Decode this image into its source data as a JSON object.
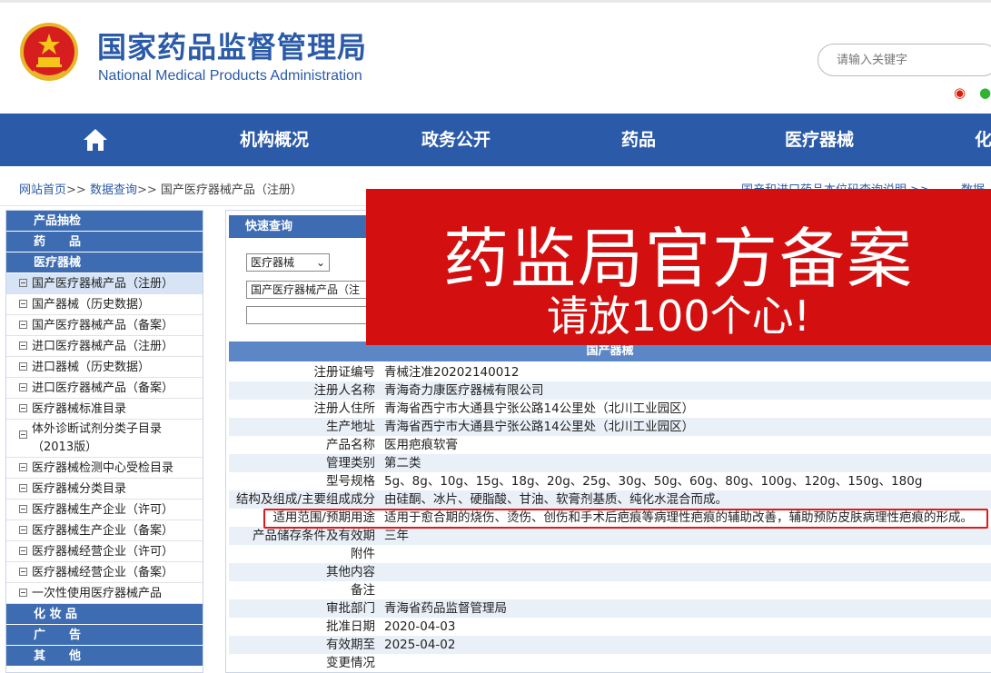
{
  "header": {
    "title_cn": "国家药品监督管理局",
    "title_en": "National Medical Products Administration",
    "search_placeholder": "请输入关键字"
  },
  "nav": {
    "items": [
      "机构概况",
      "政务公开",
      "药品",
      "医疗器械",
      "化"
    ]
  },
  "breadcrumb": {
    "home": "网站首页",
    "sep": ">>",
    "data_query": "数据查询",
    "current": "国产医疗器械产品（注册）",
    "right_link": "国产和进口药品本位码查询说明  >>",
    "right_link2": "数据查"
  },
  "sidebar": {
    "categories": [
      "产品抽检",
      "药　　品",
      "医疗器械",
      "化 妆 品",
      "广　　告",
      "其　　他"
    ],
    "items": [
      "国产医疗器械产品（注册）",
      "国产器械（历史数据）",
      "国产医疗器械产品（备案）",
      "进口医疗器械产品（注册）",
      "进口器械（历史数据）",
      "进口医疗器械产品（备案）",
      "医疗器械标准目录",
      "体外诊断试剂分类子目录（2013版）",
      "医疗器械检测中心受检目录",
      "医疗器械分类目录",
      "医疗器械生产企业（许可）",
      "医疗器械生产企业（备案）",
      "医疗器械经营企业（许可）",
      "医疗器械经营企业（备案）",
      "一次性使用医疗器械产品"
    ]
  },
  "quick_search": {
    "title": "快速查询",
    "category_select": "医疗器械",
    "db_select": "国产医疗器械产品（注"
  },
  "banner": {
    "main": "药监局官方备案",
    "sub": "请放100个心!"
  },
  "table": {
    "title": "国产器械",
    "rows": [
      {
        "k": "注册证编号",
        "v": "青械注准20202140012"
      },
      {
        "k": "注册人名称",
        "v": "青海奇力康医疗器械有限公司"
      },
      {
        "k": "注册人住所",
        "v": "青海省西宁市大通县宁张公路14公里处（北川工业园区）"
      },
      {
        "k": "生产地址",
        "v": "青海省西宁市大通县宁张公路14公里处（北川工业园区）"
      },
      {
        "k": "产品名称",
        "v": "医用疤痕软膏"
      },
      {
        "k": "管理类别",
        "v": "第二类"
      },
      {
        "k": "型号规格",
        "v": "5g、8g、10g、15g、18g、20g、25g、30g、50g、60g、80g、100g、120g、150g、180g"
      },
      {
        "k": "结构及组成/主要组成成分",
        "v": "由硅酮、冰片、硬脂酸、甘油、软膏剂基质、纯化水混合而成。"
      },
      {
        "k": "适用范围/预期用途",
        "v": "适用于愈合期的烧伤、烫伤、创伤和手术后疤痕等病理性疤痕的辅助改善，辅助预防皮肤病理性疤痕的形成。"
      },
      {
        "k": "产品储存条件及有效期",
        "v": "三年"
      },
      {
        "k": "附件",
        "v": ""
      },
      {
        "k": "其他内容",
        "v": ""
      },
      {
        "k": "备注",
        "v": ""
      },
      {
        "k": "审批部门",
        "v": "青海省药品监督管理局"
      },
      {
        "k": "批准日期",
        "v": "2020-04-03"
      },
      {
        "k": "有效期至",
        "v": "2025-04-02"
      },
      {
        "k": "变更情况",
        "v": ""
      }
    ]
  },
  "colors": {
    "brand_blue": "#2a5aa8",
    "banner_red": "#d40f0f",
    "highlight_red": "#e01818"
  }
}
